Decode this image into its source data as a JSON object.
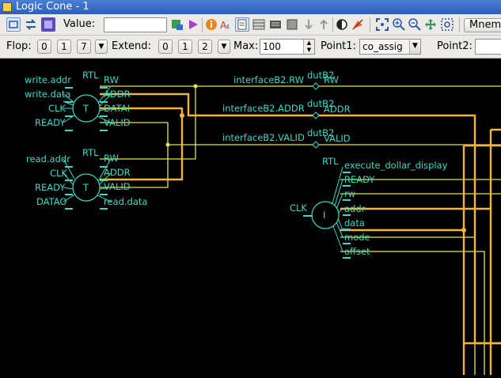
{
  "window": {
    "title": "Logic Cone - 1"
  },
  "toolbar1": {
    "value_label": "Value:",
    "value_input": "",
    "mnem_label": "Mnem",
    "icons": [
      "select-mode-icon",
      "swap-icon",
      "run-icon",
      "value-picker-icon",
      "back-trace-icon",
      "forward-icon",
      "info-icon",
      "text-annotate-icon",
      "document-icon",
      "grid-icon",
      "bus-icon",
      "memory-icon",
      "trace-down-icon",
      "trace-up-icon",
      "contrast-icon",
      "clear-icon",
      "fit-icon",
      "zoom-in-icon",
      "zoom-out-icon",
      "pan-icon",
      "zoom-box-icon"
    ]
  },
  "toolbar2": {
    "flop_label": "Flop:",
    "flop_buttons": [
      "0",
      "1",
      "7"
    ],
    "extend_label": "Extend:",
    "extend_buttons": [
      "0",
      "1",
      "2"
    ],
    "max_label": "Max:",
    "max_value": "100",
    "point1_label": "Point1:",
    "point1_value": "co_assig",
    "point2_label": "Point2:"
  },
  "schematic": {
    "colors": {
      "wire_bus": "#f2b53a",
      "wire_signal": "#e4e64a",
      "label": "#3fd7c8",
      "background": "#000000"
    },
    "blocks": [
      {
        "symbol": "T",
        "tag": "RTL",
        "inputs": [
          "write.addr",
          "write.data",
          "CLK",
          "READY"
        ],
        "outputs": [
          "RW",
          "ADDR",
          "DATAI",
          "VALID"
        ]
      },
      {
        "symbol": "T",
        "tag": "RTL",
        "inputs": [
          "read.addr",
          "CLK",
          "READY",
          "DATAO"
        ],
        "outputs": [
          "RW",
          "ADDR",
          "VALID",
          "read.data"
        ]
      },
      {
        "symbol": "I",
        "tag": "RTL",
        "inputs": [
          "CLK"
        ],
        "outputs": [
          "execute_dollar_display",
          "READY",
          "rw",
          "addr",
          "data",
          "mode",
          "offset"
        ]
      }
    ],
    "interfaces": [
      {
        "net": "interfaceB2.RW",
        "inst": "dutB2",
        "port": "RW"
      },
      {
        "net": "interfaceB2.ADDR",
        "inst": "dutB2",
        "port": "ADDR"
      },
      {
        "net": "interfaceB2.VALID",
        "inst": "dutB2",
        "port": "VALID"
      }
    ]
  }
}
